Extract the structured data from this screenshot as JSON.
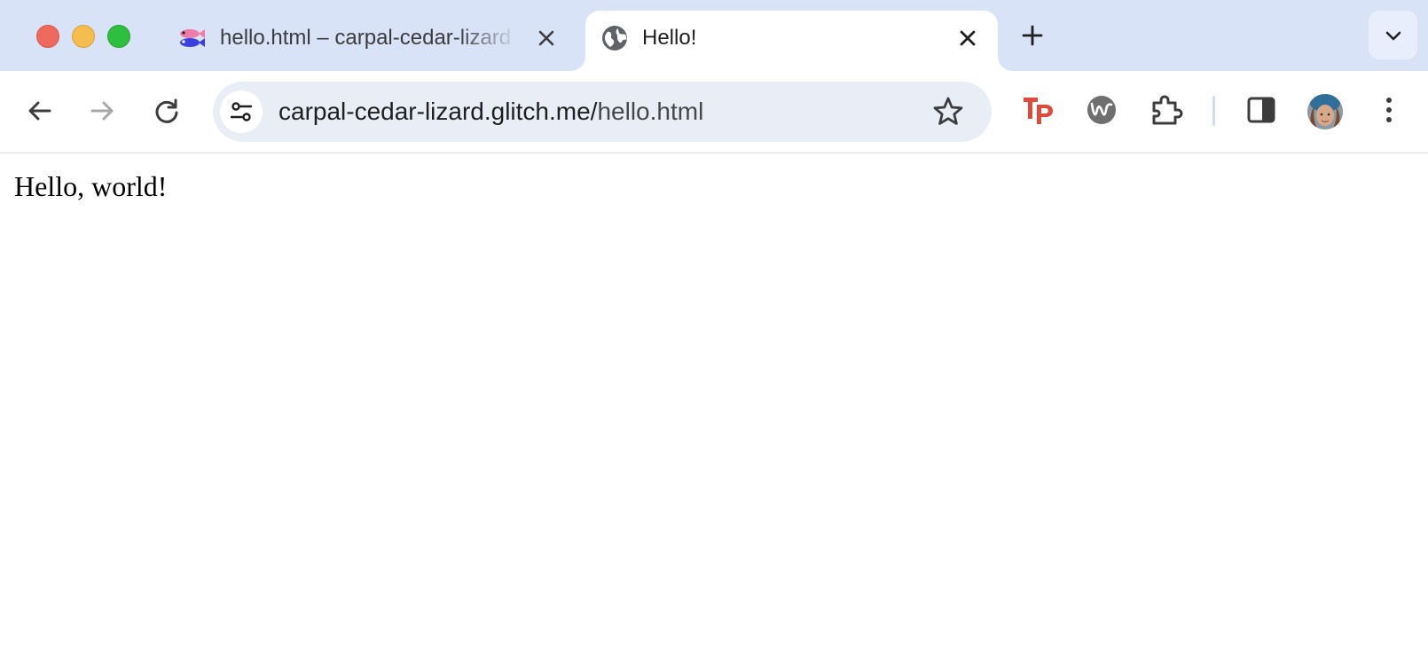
{
  "window": {
    "controls": [
      "close",
      "minimize",
      "zoom"
    ]
  },
  "tabs": [
    {
      "title": "hello.html – carpal-cedar-lizard",
      "favicon": "glitch-fish-icon",
      "active": false
    },
    {
      "title": "Hello!",
      "favicon": "globe-icon",
      "active": true
    }
  ],
  "toolbar": {
    "back_icon": "arrow-left-icon",
    "forward_icon": "arrow-right-icon",
    "reload_icon": "reload-icon",
    "url_host": "carpal-cedar-lizard.glitch.me/",
    "url_path": "hello.html",
    "extensions": [
      "tp-extension-icon",
      "w-extension-icon",
      "puzzle-extensions-icon"
    ],
    "sidepanel_icon": "side-panel-icon",
    "menu_icon": "kebab-menu-icon"
  },
  "page": {
    "text": "Hello, world!"
  },
  "colors": {
    "tabstrip_bg": "#d8e3f8",
    "omnibox_bg": "#e9eef6",
    "tp_red": "#e04a3a"
  }
}
